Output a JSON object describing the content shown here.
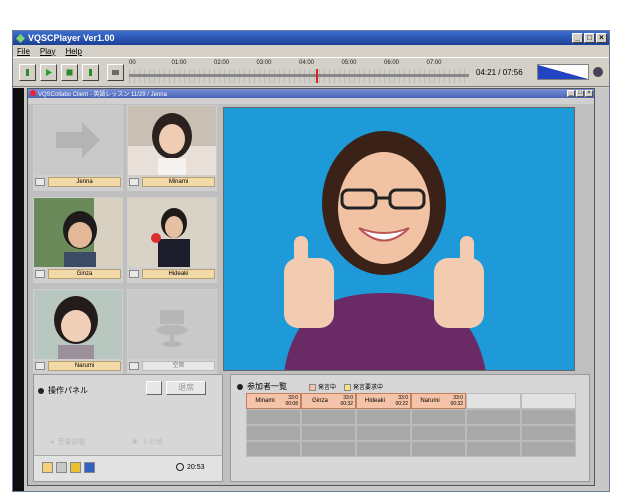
{
  "app": {
    "title": "VQSCPlayer Ver1.00",
    "window_buttons": [
      "_",
      "□",
      "×"
    ],
    "menu": [
      "File",
      "Play",
      "Help"
    ]
  },
  "player": {
    "timeline_ticks": [
      "00",
      "01:00",
      "02:00",
      "03:00",
      "04:00",
      "05:00",
      "06:00",
      "07:00"
    ],
    "current_time": "04:21",
    "total_time": "07:56",
    "timecode_display": "04:21 / 07:56",
    "progress_fraction": 0.55
  },
  "session": {
    "title": "VQSCollabo Client - 英語レッスン 11/29 / Jenna"
  },
  "tiles": [
    {
      "name": "Jenna",
      "kind": "empty-arrow"
    },
    {
      "name": "Minami",
      "kind": "photo"
    },
    {
      "name": "Ginza",
      "kind": "photo"
    },
    {
      "name": "Hideaki",
      "kind": "photo"
    },
    {
      "name": "Narumi",
      "kind": "photo"
    },
    {
      "name": "空席",
      "kind": "empty-seat"
    }
  ],
  "panel": {
    "title": "操作パネル",
    "button_label": "退席",
    "item_volume": "音量調整",
    "item_other": "その他",
    "clock": "20:53"
  },
  "participants": {
    "title": "参加者一覧",
    "legend_speaking": "発言中",
    "legend_request": "発言要求中",
    "entries": [
      {
        "name": "Minami",
        "a": "33:0",
        "b": "00:08"
      },
      {
        "name": "Ginza",
        "a": "33:0",
        "b": "00:32"
      },
      {
        "name": "Hideaki",
        "a": "33:0",
        "b": "00:22"
      },
      {
        "name": "Narumi",
        "a": "33:0",
        "b": "00:32"
      }
    ]
  },
  "colors": {
    "title_blue": "#1d3f96",
    "video_bg": "#1f9ad8",
    "seek_marker": "#e0202a",
    "participant_cell": "#f5c3a8"
  }
}
